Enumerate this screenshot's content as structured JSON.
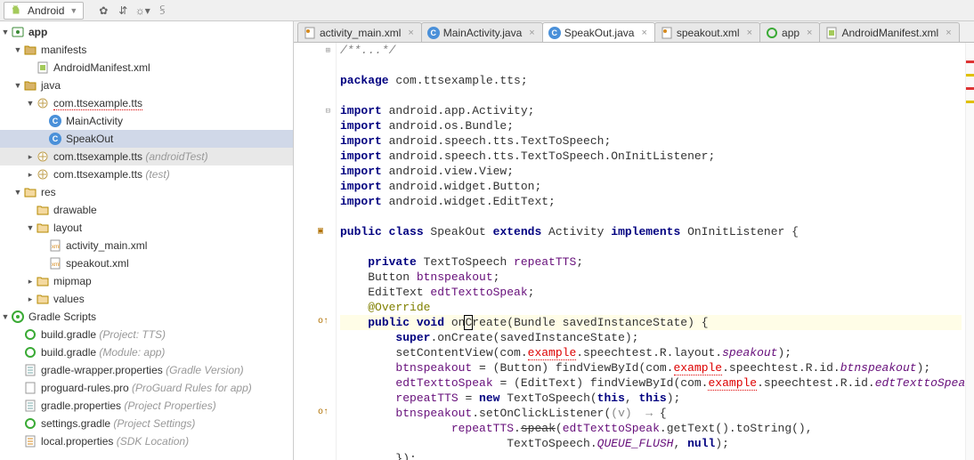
{
  "toolbar": {
    "module": "Android",
    "module_icon": "android-icon"
  },
  "project_tree": {
    "root": {
      "label": "app",
      "icon": "app-module"
    },
    "manifests": {
      "label": "manifests"
    },
    "manifest_file": {
      "label": "AndroidManifest.xml"
    },
    "java": {
      "label": "java"
    },
    "pkg_main": {
      "label": "com.ttsexample.tts"
    },
    "cls_main_activity": {
      "label": "MainActivity"
    },
    "cls_speak_out": {
      "label": "SpeakOut"
    },
    "pkg_android_test": {
      "label": "com.ttsexample.tts",
      "suffix": " (androidTest)"
    },
    "pkg_test": {
      "label": "com.ttsexample.tts",
      "suffix": " (test)"
    },
    "res": {
      "label": "res"
    },
    "drawable": {
      "label": "drawable"
    },
    "layout": {
      "label": "layout"
    },
    "layout_activity_main": {
      "label": "activity_main.xml"
    },
    "layout_speakout": {
      "label": "speakout.xml"
    },
    "mipmap": {
      "label": "mipmap"
    },
    "values": {
      "label": "values"
    },
    "gradle_scripts": {
      "label": "Gradle Scripts"
    },
    "build_gradle_project": {
      "label": "build.gradle",
      "suffix": " (Project: TTS)"
    },
    "build_gradle_module": {
      "label": "build.gradle",
      "suffix": " (Module: app)"
    },
    "gradle_wrapper": {
      "label": "gradle-wrapper.properties",
      "suffix": " (Gradle Version)"
    },
    "proguard": {
      "label": "proguard-rules.pro",
      "suffix": " (ProGuard Rules for app)"
    },
    "gradle_props": {
      "label": "gradle.properties",
      "suffix": " (Project Properties)"
    },
    "settings_gradle": {
      "label": "settings.gradle",
      "suffix": " (Project Settings)"
    },
    "local_props": {
      "label": "local.properties",
      "suffix": " (SDK Location)"
    }
  },
  "tabs": [
    {
      "label": "activity_main.xml",
      "icon": "xml-icon",
      "active": false
    },
    {
      "label": "MainActivity.java",
      "icon": "java-c-icon",
      "active": false
    },
    {
      "label": "SpeakOut.java",
      "icon": "java-c-icon",
      "active": true
    },
    {
      "label": "speakout.xml",
      "icon": "xml-icon",
      "active": false
    },
    {
      "label": "app",
      "icon": "gradle-icon",
      "active": false
    },
    {
      "label": "AndroidManifest.xml",
      "icon": "manifest-icon",
      "active": false
    }
  ],
  "code": {
    "file": "SpeakOut.java",
    "lines": [
      {
        "gutter": "fold+",
        "html": "<span class='cm'>/**...*/</span>"
      },
      {
        "gutter": "",
        "html": ""
      },
      {
        "gutter": "",
        "html": "<span class='kw'>package</span> com.ttsexample.tts;"
      },
      {
        "gutter": "",
        "html": ""
      },
      {
        "gutter": "fold",
        "html": "<span class='kw'>import</span> android.app.Activity;"
      },
      {
        "gutter": "",
        "html": "<span class='kw'>import</span> android.os.Bundle;"
      },
      {
        "gutter": "",
        "html": "<span class='kw'>import</span> android.speech.tts.TextToSpeech;"
      },
      {
        "gutter": "",
        "html": "<span class='kw'>import</span> android.speech.tts.TextToSpeech.OnInitListener;"
      },
      {
        "gutter": "",
        "html": "<span class='kw'>import</span> android.view.View;"
      },
      {
        "gutter": "",
        "html": "<span class='kw'>import</span> android.widget.Button;"
      },
      {
        "gutter": "",
        "html": "<span class='kw'>import</span> android.widget.EditText;"
      },
      {
        "gutter": "",
        "html": ""
      },
      {
        "gutter": "mk-class",
        "html": "<span class='kw'>public class</span> SpeakOut <span class='kw'>extends</span> Activity <span class='kw'>implements</span> OnInitListener {"
      },
      {
        "gutter": "",
        "html": ""
      },
      {
        "gutter": "",
        "html": "    <span class='kw'>private</span> TextToSpeech <span class='fld'>repeatTTS</span>;"
      },
      {
        "gutter": "",
        "html": "    Button <span class='fld'>btnspeakout</span>;"
      },
      {
        "gutter": "",
        "html": "    EditText <span class='fld'>edtTexttoSpeak</span>;"
      },
      {
        "gutter": "",
        "html": "    <span class='ann'>@Override</span>"
      },
      {
        "gutter": "mk-ov",
        "cursor": true,
        "html": "    <span class='kw'>public void</span> on<span class='caret'>C</span>reate(Bundle savedInstanceState) {"
      },
      {
        "gutter": "",
        "html": "        <span class='kw'>super</span>.onCreate(savedInstanceState);"
      },
      {
        "gutter": "",
        "html": "        setContentView(com.<span class='err'>example</span>.speechtest.R.layout.<span class='fld it'>speakout</span>);"
      },
      {
        "gutter": "",
        "html": "        <span class='fld'>btnspeakout</span> = (Button) findViewById(com.<span class='err'>example</span>.speechtest.R.id.<span class='fld it'>btnspeakout</span>);"
      },
      {
        "gutter": "",
        "html": "        <span class='fld'>edtTexttoSpeak</span> = (EditText) findViewById(com.<span class='err'>example</span>.speechtest.R.id.<span class='fld it'>edtTexttoSpeak</span>);"
      },
      {
        "gutter": "",
        "html": "        <span class='fld'>repeatTTS</span> = <span class='kw'>new</span> TextToSpeech(<span class='kw'>this</span>, <span class='kw'>this</span>);"
      },
      {
        "gutter": "mk-ov",
        "html": "        <span class='fld'>btnspeakout</span>.setOnClickListener(<span class='lambda'>(v)  →</span> {"
      },
      {
        "gutter": "",
        "html": "                <span class='fld'>repeatTTS</span>.<s>speak</s>(<span class='fld'>edtTexttoSpeak</span>.getText().toString(),"
      },
      {
        "gutter": "",
        "html": "                        TextToSpeech.<span class='fld it'>QUEUE_FLUSH</span>, <span class='kw'>null</span>);"
      },
      {
        "gutter": "",
        "html": "        });"
      }
    ]
  }
}
